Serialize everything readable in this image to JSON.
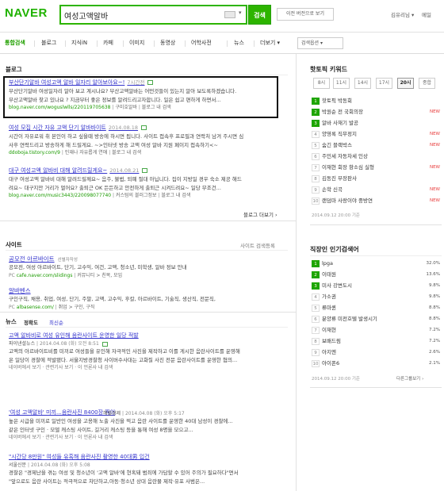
{
  "header": {
    "logo": "NAVER",
    "search_value": "여성고액알바",
    "search_button": "검색",
    "prev_version_button": "이전 버전으로 보기",
    "user": "김유리님 ▾",
    "mail": "메일"
  },
  "tabs": [
    "통합검색",
    "블로그",
    "지식iN",
    "카페",
    "이미지",
    "동영상",
    "어학사전",
    "뉴스",
    "더보기 ▾"
  ],
  "search_option": "검색옵션 ▾",
  "blog": {
    "section": "블로그",
    "items": [
      {
        "title": "부산단기알바 여성고액 알바 일자리 알아보아요~!",
        "date": "7시간전",
        "desc1": "부산단기알바 여성일자리 알아 보고 계시나요? 부산고액알바는 어떤것들이 있는지 알아 보도록하겠습니다.",
        "desc2": "부산고액알바 찾고 있나요 ? 지금부터 좋은 정보를 알려드리고자합니다. 일은 쉽고 편하게 하면서...",
        "url": "blog.naver.com/woguslwlls/220119705638",
        "blogname": "구미호알바",
        "more": "블로그 내 검색"
      },
      {
        "title": "여성 모집 시간 자유 고액 단기 알바바이트",
        "date": "2014.08.18",
        "desc1": "시간이 자유로워 취 본인이 하고 싶을때 방송에 하시면 됩니다. 사이트 접속후 프로필과 연락처 남겨 주시면 심",
        "desc2": "사후 연락드리고 방송하게 해 드릴게요. ~>인터넷 방송 고액 여성 알바 지원 페이지 접속하기<~",
        "url": "ddoboja.tistory.com/9",
        "blogname": "인재나 자유롭게 연애",
        "more": "블로그 내 검색"
      },
      {
        "title": "대구 여성고액 알바비 대해 알려드릴게요~",
        "date": "2014.08.21",
        "desc1": "대구 여성고액 알바비 대해 알려드릴께요~ 음주, 불법, 퇴폐 절대 아닙니다. 집이 지방일 경우 숙소 제공 해드",
        "desc2": "려요~ 대구지만 거리가 멀어요? 출퇴근 OK 든든하고 안전하게 출퇴근 시켜드려요~ 일당 무조건...",
        "url": "blog.naver.com/music3443/220098077740",
        "blogname": "커스텀의 블러그정보",
        "more": "블로그 내 검색"
      }
    ],
    "more_link": "블로그 더보기 ›"
  },
  "site": {
    "section": "사이트",
    "search_option": "사이트 검색등록",
    "items": [
      {
        "name": "공모전 아르바이트",
        "badge": "선별자작성",
        "desc": "공모전, 여성 아르바이트, 단기, 고수익, 여건, 고액, 청소년, 미학생, 알바 정보 안내",
        "url": "cafe.naver.com/slidings",
        "extra": "커뮤니티 > 친목, 모임"
      },
      {
        "name": "알바벤스",
        "badge": "",
        "desc": "구인구직, 채용, 취업, 여성, 단기, 주말, 고액, 고수익, 후칼, 아르바이트, 기술직, 생산직, 전문직,",
        "url": "albasense.com/",
        "extra": "취업 > 구인, 구직"
      }
    ]
  },
  "news": {
    "section": "뉴스",
    "sort_accuracy": "정확도",
    "sort_latest": "최신순",
    "items": [
      {
        "title": "고액 알바비로 여성 유인해 음란사이트 운영한 일당 적발",
        "press": "파이낸셜뉴스",
        "date": "2014.04.08 (화) 오전 8:51",
        "desc1": "고액의 아르바이트비를 미끼로 여성들을 유인해 자극적인 사진을 제작하고 이를 게시한 음란사이트를 운영해",
        "desc2": "온 일당이 경찰에 적발됐다. 서울지방경찰청 사이버수사대는 고화질 사진 전문 음란사이트를 운영한 혐의...",
        "links": "네이버에서 보기 · 관련기사 보기 · 이 언론사 내 검색"
      },
      {
        "title": "'여성 고액알바' 미끼…음란사진 8400장 찍어",
        "press": "헤럴경제",
        "date": "2014.04.08 (화) 오후 5:17",
        "desc1": "높은 시급을 미끼로 일반인 여성을 고용해 노출 사진을 찍고 음란 사이트를 운영한 40대 남성이 경찰에...",
        "desc2": "같은 인터넷 구인 · 모델 캐스팅 사이트, 길거리 캐스팅 등을 통해 여성 8명을 모으고...",
        "links": "네이버에서 보기 · 관련기사 보기 · 이 언론사 내 검색"
      },
      {
        "title": "\"시간당 8만원\" 여성들 유혹해 음란사진 촬영한 40대男 입건",
        "press": "서울신문",
        "date": "2014.04.08 (화) 오후 5:08",
        "desc1": "경찰은 \"경제난을 겪는 여성 및 청소년이 '고액 알바'에 현혹돼 범죄에 가담할 수 있어 주의가 필요하다\"면서",
        "desc2": "\"앞으로도 음란 사이트는 적극적으로 차단하고,아동·청소년 상대 음란물 제작·유포 사범은...",
        "links": ""
      }
    ]
  },
  "hot_keywords": {
    "section": "핫토픽 키워드",
    "times": [
      "8시",
      "11시",
      "14시",
      "17시",
      "20시",
      "종합"
    ],
    "active_time": "20시",
    "items": [
      {
        "rank": "1",
        "text": "핫토픽 박동회",
        "new": ""
      },
      {
        "rank": "2",
        "text": "박원순 전 국회의장",
        "new": "NEW"
      },
      {
        "rank": "3",
        "text": "알바 사재기 발공",
        "new": ""
      },
      {
        "rank": "4",
        "text": "양영록 직무정지",
        "new": "NEW"
      },
      {
        "rank": "5",
        "text": "숨긴 블랙박스",
        "new": "NEW"
      },
      {
        "rank": "6",
        "text": "주민세 자동차세 인상",
        "new": ""
      },
      {
        "rank": "7",
        "text": "이재현 회장 항소심 실형",
        "new": "NEW"
      },
      {
        "rank": "8",
        "text": "김동진 부장판사",
        "new": ""
      },
      {
        "rank": "9",
        "text": "손학 신곡",
        "new": "NEW"
      },
      {
        "rank": "10",
        "text": "랜덤마 사랑이야 중방연",
        "new": "NEW"
      }
    ],
    "footer": "2014.09.12 20:00 기준"
  },
  "popular": {
    "section": "직장인 인기검색어",
    "items": [
      {
        "rank": "1",
        "text": "lpga",
        "pct": "32.0%"
      },
      {
        "rank": "2",
        "text": "이태원",
        "pct": "13.6%"
      },
      {
        "rank": "3",
        "text": "미사 강변도시",
        "pct": "9.8%"
      },
      {
        "rank": "4",
        "text": "가소권",
        "pct": "9.8%"
      },
      {
        "rank": "5",
        "text": "류마퀸",
        "pct": "8.8%"
      },
      {
        "rank": "6",
        "text": "분양류 미전호텔 발생시기",
        "pct": "8.8%"
      },
      {
        "rank": "7",
        "text": "이재현",
        "pct": "7.2%"
      },
      {
        "rank": "8",
        "text": "보배드림",
        "pct": "7.2%"
      },
      {
        "rank": "9",
        "text": "아지엔",
        "pct": "2.6%"
      },
      {
        "rank": "10",
        "text": "아이폰6",
        "pct": "2.1%"
      }
    ],
    "footer": "2014.09.12 20:00 기준",
    "more": "다른그룹보기 ›"
  },
  "colors": {
    "brand": "#2db400",
    "link": "#3333cc",
    "url": "#1b9b00",
    "new": "#e83c3c"
  }
}
